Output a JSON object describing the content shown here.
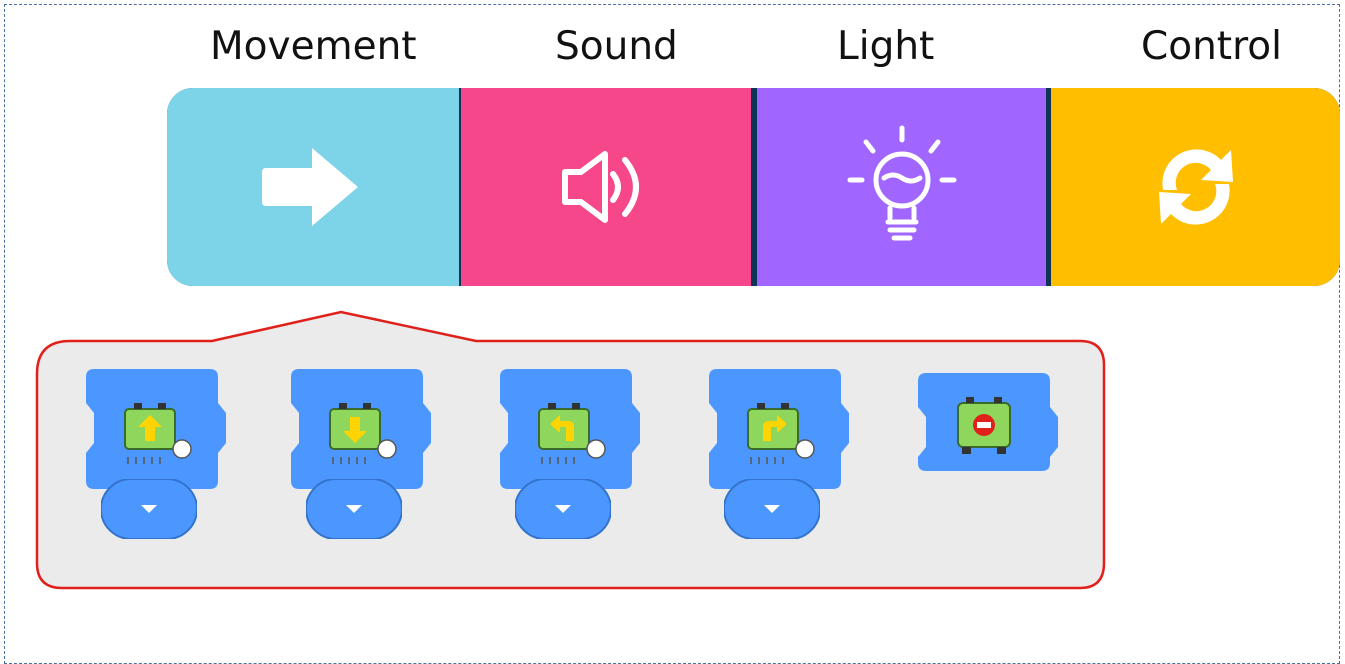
{
  "categories": [
    {
      "label": "Movement",
      "icon": "arrow-right-icon",
      "color": "#7dd3e8",
      "selected": true
    },
    {
      "label": "Sound",
      "icon": "speaker-icon",
      "color": "#f5478a"
    },
    {
      "label": "Light",
      "icon": "lightbulb-icon",
      "color": "#a066ff"
    },
    {
      "label": "Control",
      "icon": "refresh-icon",
      "color": "#ffbf00"
    }
  ],
  "palette": {
    "highlight_color": "#e0201a",
    "background": "#ebebeb",
    "blocks": [
      {
        "name": "move-forward",
        "icon": "forward-arrow-icon",
        "has_dropdown": true
      },
      {
        "name": "move-backward",
        "icon": "backward-arrow-icon",
        "has_dropdown": true
      },
      {
        "name": "turn-left",
        "icon": "turn-left-arrow-icon",
        "has_dropdown": true
      },
      {
        "name": "turn-right",
        "icon": "turn-right-arrow-icon",
        "has_dropdown": true
      },
      {
        "name": "stop",
        "icon": "stop-icon",
        "has_dropdown": false
      }
    ],
    "block_color": "#4c97ff"
  }
}
